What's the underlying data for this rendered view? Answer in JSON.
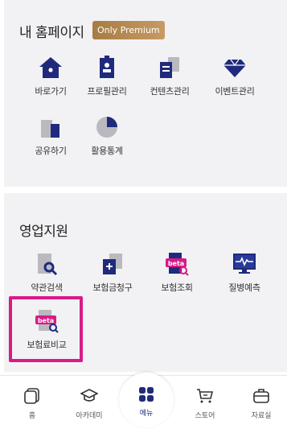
{
  "my_homepage": {
    "title": "내 홈페이지",
    "badge": "Only Premium",
    "items": [
      {
        "label": "바로가기",
        "icon": "home-icon"
      },
      {
        "label": "프로필관리",
        "icon": "profile-card-icon"
      },
      {
        "label": "컨텐츠관리",
        "icon": "contents-icon"
      },
      {
        "label": "이벤트관리",
        "icon": "diamond-icon"
      },
      {
        "label": "공유하기",
        "icon": "share-icon"
      },
      {
        "label": "활용통계",
        "icon": "pie-chart-icon"
      }
    ]
  },
  "sales_support": {
    "title": "영업지원",
    "items": [
      {
        "label": "약관검색",
        "icon": "document-search-icon"
      },
      {
        "label": "보험금청구",
        "icon": "claim-icon"
      },
      {
        "label": "보험조회",
        "icon": "beta-lookup-icon",
        "tag": "beta"
      },
      {
        "label": "질병예측",
        "icon": "monitor-pulse-icon"
      },
      {
        "label": "보험료비교",
        "icon": "beta-compare-icon",
        "tag": "beta"
      }
    ]
  },
  "tabbar": {
    "items": [
      {
        "label": "홈",
        "icon": "home-outline-icon"
      },
      {
        "label": "아카데미",
        "icon": "graduation-cap-icon"
      },
      {
        "label": "메뉴",
        "icon": "menu-grid-icon",
        "active": true
      },
      {
        "label": "스토어",
        "icon": "cart-icon"
      },
      {
        "label": "자료실",
        "icon": "briefcase-icon"
      }
    ]
  },
  "colors": {
    "primary": "#1f2a7c",
    "accent": "#d81b87",
    "gray": "#b9b9bf",
    "badge": "#b48a55",
    "background": "#f2f2f4"
  }
}
